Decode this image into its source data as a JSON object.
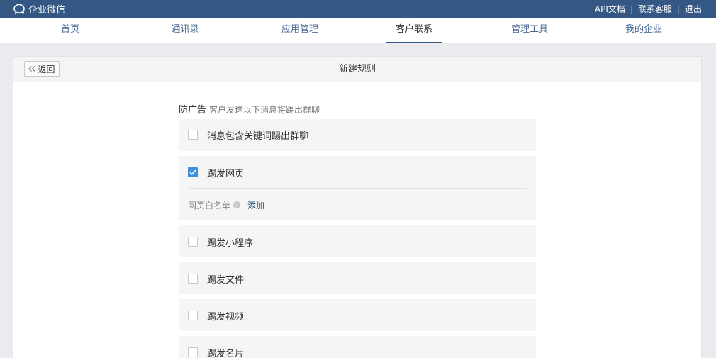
{
  "brand": {
    "name": "企业微信",
    "icon": "chat-bubble-icon"
  },
  "top_links": [
    {
      "label": "API文档"
    },
    {
      "label": "联系客服"
    },
    {
      "label": "退出"
    }
  ],
  "nav": {
    "tabs": [
      {
        "label": "首页"
      },
      {
        "label": "通讯录"
      },
      {
        "label": "应用管理"
      },
      {
        "label": "客户联系",
        "active": true
      },
      {
        "label": "管理工具"
      },
      {
        "label": "我的企业"
      }
    ]
  },
  "panel": {
    "back_label": "返回",
    "title": "新建规则"
  },
  "section": {
    "title": "防广告",
    "description": "客户发送以下消息将踢出群聊"
  },
  "options": [
    {
      "label": "消息包含关键词踢出群聊",
      "checked": false
    },
    {
      "label": "踢发网页",
      "checked": true,
      "whitelist_label": "网页白名单",
      "add_label": "添加"
    },
    {
      "label": "踢发小程序",
      "checked": false
    },
    {
      "label": "踢发文件",
      "checked": false
    },
    {
      "label": "踢发视频",
      "checked": false
    },
    {
      "label": "踢发名片",
      "checked": false
    }
  ],
  "colors": {
    "topbar": "#355784",
    "accent_check": "#3e8fe0",
    "link": "#355784"
  }
}
